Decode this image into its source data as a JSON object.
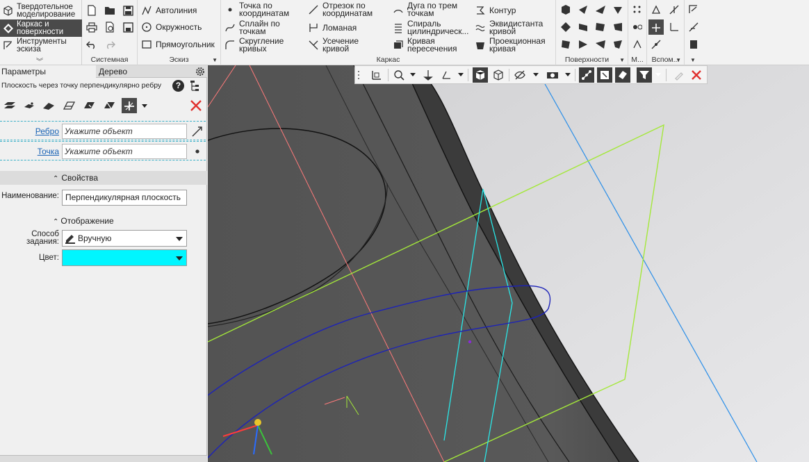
{
  "ribbon": {
    "modes": [
      {
        "label": "Твердотельное\nмоделирование",
        "icon": "solid-modeling-icon",
        "active": false
      },
      {
        "label": "Каркас и\nповерхности",
        "icon": "wireframe-surfaces-icon",
        "active": true
      },
      {
        "label": "Инструменты\nэскиза",
        "icon": "sketch-tools-icon",
        "active": false
      }
    ],
    "sections": {
      "system": "Системная",
      "sketch": "Эскиз",
      "wireframe": "Каркас",
      "surfaces": "Поверхности",
      "m": "М...",
      "aux": "Вспом..."
    },
    "sketch_cmds": {
      "autoline": "Автолиния",
      "circle": "Окружность",
      "rectangle": "Прямоугольник"
    },
    "wire_cmds": {
      "point_coords": "Точка по\nкоординатам",
      "spline_points": "Сплайн по\nточкам",
      "fillet_curves": "Скругление\nкривых",
      "segment_coords": "Отрезок по\nкоординатам",
      "polyline": "Ломаная",
      "trim_curve": "Усечение\nкривой",
      "arc_three": "Дуга по трем\nточкам",
      "spiral_cyl": "Спираль\nцилиндрическ...",
      "intersection_curve": "Кривая\nпересечения",
      "contour": "Контур",
      "equidistant": "Эквидистанта\nкривой",
      "projection_curve": "Проекционная\nкривая"
    }
  },
  "panel": {
    "tab_params": "Параметры",
    "tab_tree": "Дерево",
    "subtitle": "Плоскость через точку перпендикулярно ребру",
    "help": "?",
    "fields": {
      "edge_label": "Ребро",
      "edge_placeholder": "Укажите объект",
      "point_label": "Точка",
      "point_placeholder": "Укажите объект"
    },
    "properties": {
      "header": "Свойства",
      "name_label": "Наименование:",
      "name_value": "Перпендикулярная плоскость",
      "display_header": "Отображение",
      "method_label": "Способ\nзадания:",
      "method_value": "Вручную",
      "color_label": "Цвет:",
      "color_value": "#00f6ff"
    }
  },
  "colors": {
    "accent_dark": "#4a4a4a",
    "link": "#1a63b5",
    "plane_cyan": "#00f6ff",
    "curve_blue": "#1c22b8",
    "plane_green": "#a4e83a",
    "axis_blue": "#2a8ee8",
    "axis_red": "#ff7a7a"
  }
}
